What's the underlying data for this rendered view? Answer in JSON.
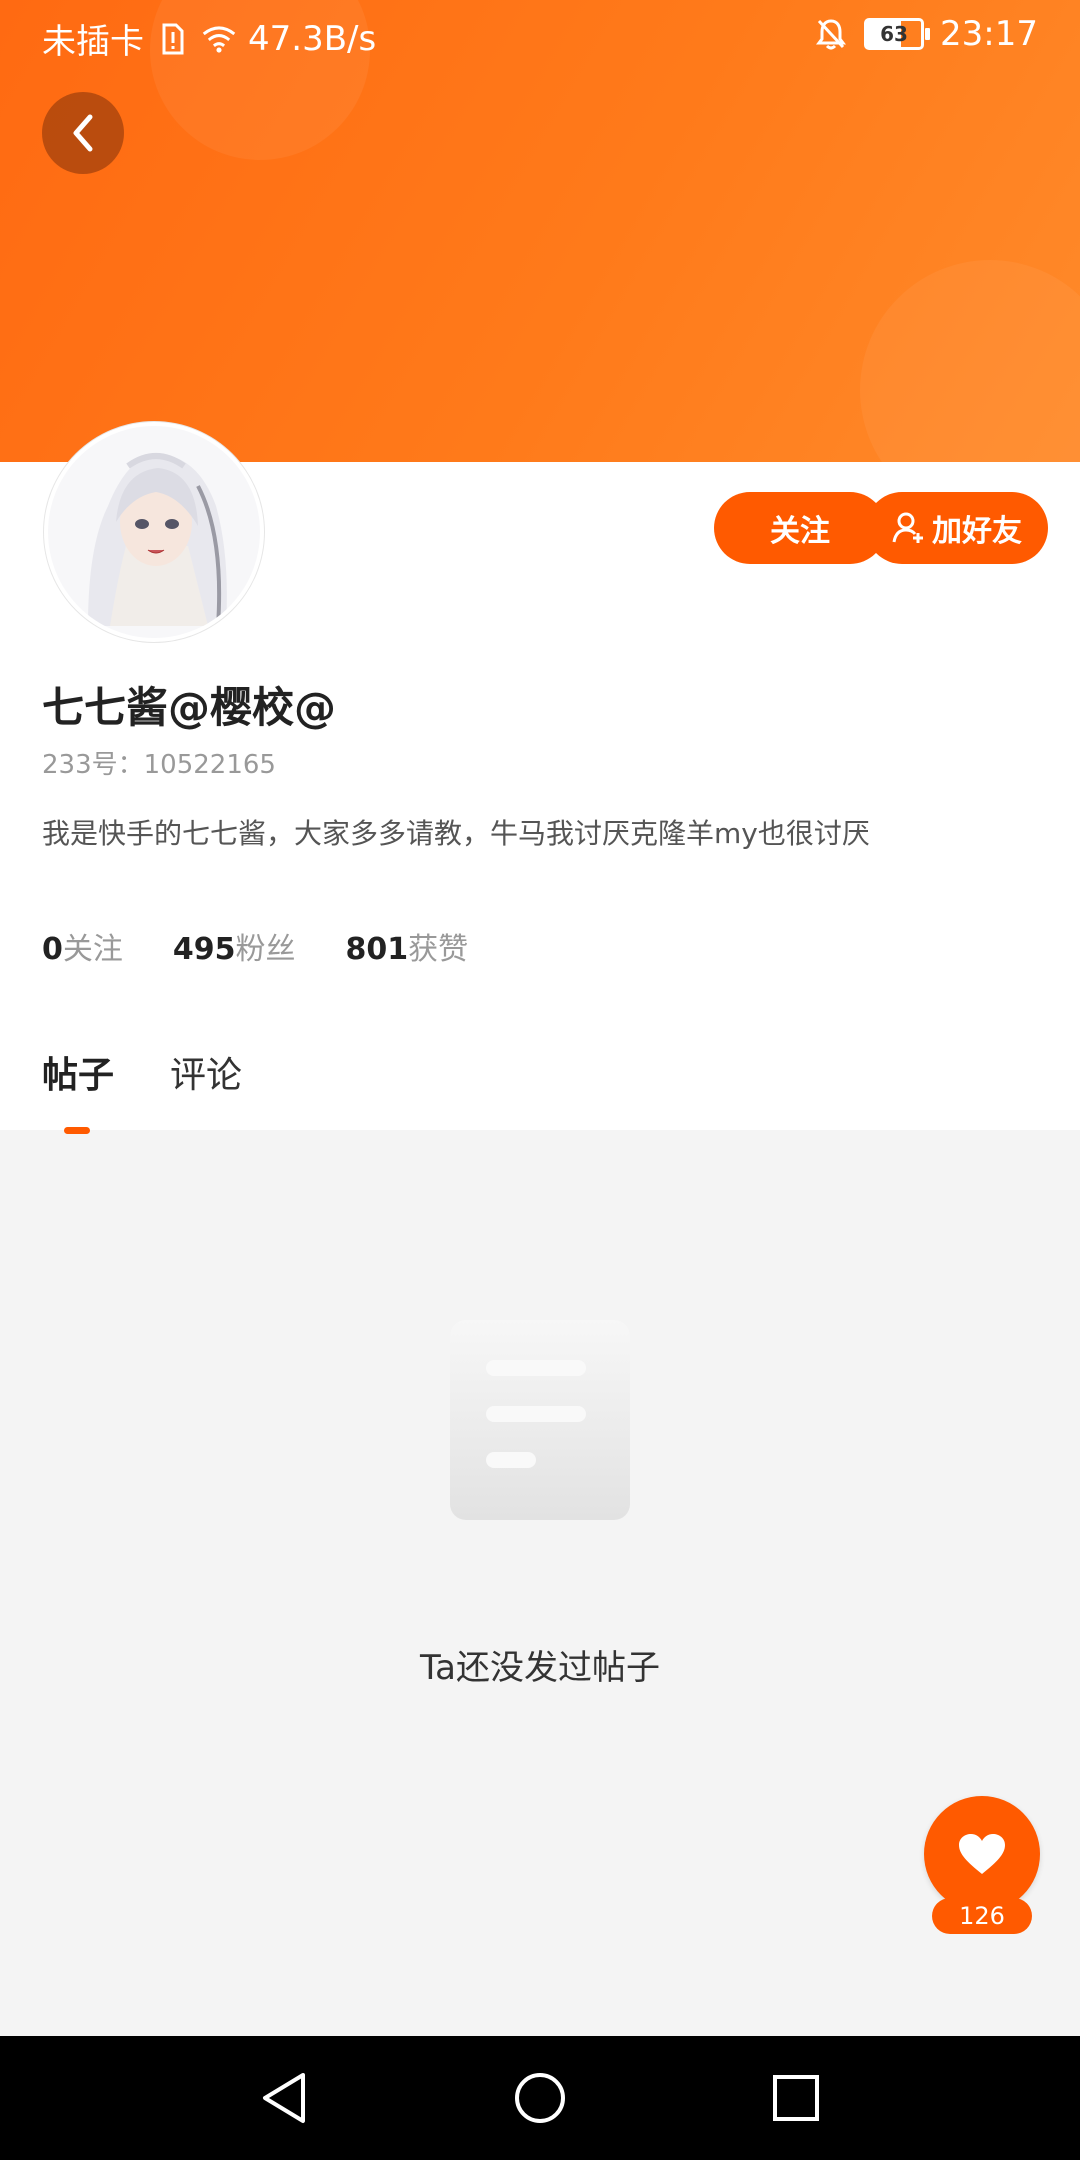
{
  "status_bar": {
    "carrier": "未插卡",
    "speed": "47.3B/s",
    "battery": "63",
    "time": "23:17",
    "icons": [
      "sim-alert-icon",
      "wifi-icon",
      "mute-bell-icon",
      "battery-icon"
    ]
  },
  "profile": {
    "name": "七七酱@樱校@",
    "uid_label": "233号：10522165",
    "bio": "我是快手的七七酱，大家多多请教，牛马我讨厌克隆羊my也很讨厌"
  },
  "actions": {
    "follow_label": "关注",
    "add_friend_label": "加好友"
  },
  "stats": [
    {
      "value": "0",
      "label": "关注"
    },
    {
      "value": "495",
      "label": "粉丝"
    },
    {
      "value": "801",
      "label": "获赞"
    }
  ],
  "tabs": [
    {
      "label": "帖子",
      "active": true
    },
    {
      "label": "评论",
      "active": false
    }
  ],
  "empty_state": {
    "text": "Ta还没发过帖子"
  },
  "like_fab": {
    "count": "126"
  },
  "colors": {
    "accent": "#ff5a00",
    "banner": "#ff7a1a",
    "background": "#f4f4f4"
  }
}
